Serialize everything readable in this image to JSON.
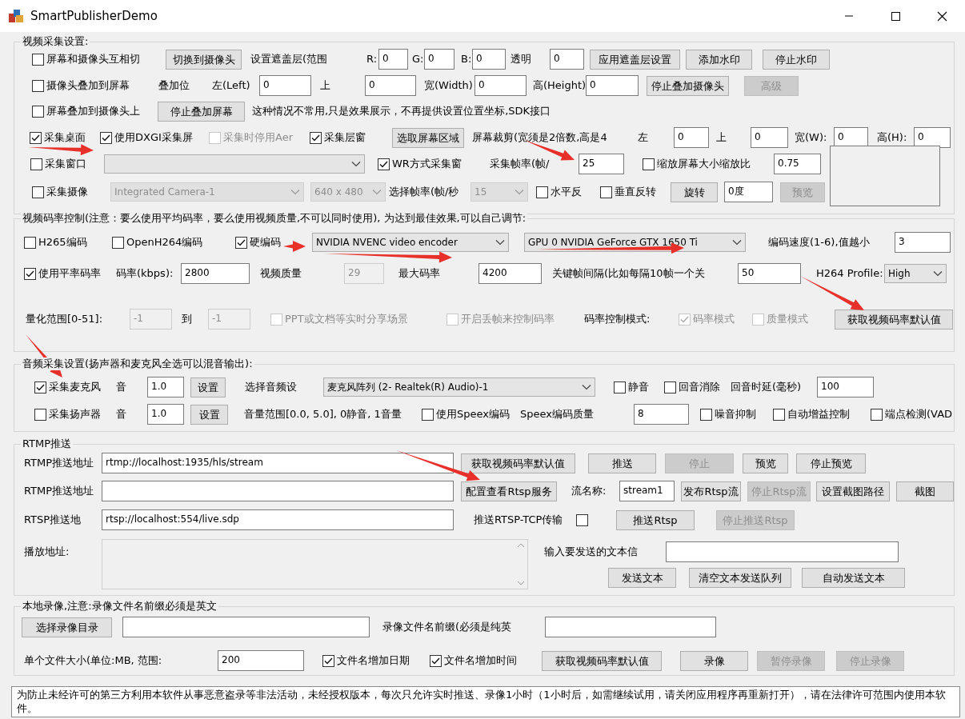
{
  "window": {
    "title": "SmartPublisherDemo"
  },
  "sections": [
    {
      "title": "视频采集设置:",
      "rows": [
        {
          "items": [
            {
              "kind": "checkbox",
              "label": "屏幕和摄像头互相切",
              "checked": false,
              "disabled": false
            },
            {
              "kind": "button",
              "label": "切换到摄像头",
              "disabled": false
            },
            {
              "kind": "label",
              "text": "设置遮盖层(范围"
            },
            {
              "kind": "label",
              "text": "R:"
            },
            {
              "kind": "field",
              "value": "0",
              "disabled": false
            },
            {
              "kind": "label",
              "text": "G:"
            },
            {
              "kind": "field",
              "value": "0",
              "disabled": false
            },
            {
              "kind": "label",
              "text": "B:"
            },
            {
              "kind": "field",
              "value": "0",
              "disabled": false
            },
            {
              "kind": "label",
              "text": "透明"
            },
            {
              "kind": "field",
              "value": "0",
              "disabled": false
            },
            {
              "kind": "button",
              "label": "应用遮盖层设置",
              "disabled": false
            },
            {
              "kind": "button",
              "label": "添加水印",
              "disabled": false
            },
            {
              "kind": "button",
              "label": "停止水印",
              "disabled": false
            }
          ]
        },
        {
          "items": [
            {
              "kind": "checkbox",
              "label": "摄像头叠加到屏幕",
              "checked": false,
              "disabled": false
            },
            {
              "kind": "label",
              "text": "叠加位"
            },
            {
              "kind": "label",
              "text": "左(Left)"
            },
            {
              "kind": "field",
              "value": "0",
              "disabled": false
            },
            {
              "kind": "label",
              "text": "上"
            },
            {
              "kind": "field",
              "value": "0",
              "disabled": false
            },
            {
              "kind": "label",
              "text": "宽(Width)"
            },
            {
              "kind": "field",
              "value": "0",
              "disabled": false
            },
            {
              "kind": "label",
              "text": "高(Height)"
            },
            {
              "kind": "field",
              "value": "0",
              "disabled": false
            },
            {
              "kind": "button",
              "label": "停止叠加摄像头",
              "disabled": false
            },
            {
              "kind": "button",
              "label": "高级",
              "disabled": true
            }
          ]
        },
        {
          "items": [
            {
              "kind": "checkbox",
              "label": "屏幕叠加到摄像头上",
              "checked": false,
              "disabled": false
            },
            {
              "kind": "button",
              "label": "停止叠加屏幕",
              "disabled": false
            },
            {
              "kind": "label",
              "text": "这种情况不常用,只是效果展示，不再提供设置位置坐标,SDK接口"
            }
          ]
        },
        {
          "items": [
            {
              "kind": "checkbox",
              "label": "采集桌面",
              "checked": true,
              "disabled": false
            },
            {
              "kind": "checkbox",
              "label": "使用DXGI采集屏",
              "checked": true,
              "disabled": false
            },
            {
              "kind": "checkbox",
              "label": "采集时停用Aer",
              "checked": false,
              "disabled": true
            },
            {
              "kind": "checkbox",
              "label": "采集层窗",
              "checked": true,
              "disabled": false
            },
            {
              "kind": "button",
              "label": "选取屏幕区域",
              "disabled": false
            },
            {
              "kind": "label",
              "text": "屏幕裁剪(宽须是2倍数,高是4"
            },
            {
              "kind": "label",
              "text": "左"
            },
            {
              "kind": "field",
              "value": "0",
              "disabled": false
            },
            {
              "kind": "label",
              "text": "上"
            },
            {
              "kind": "field",
              "value": "0",
              "disabled": false
            },
            {
              "kind": "label",
              "text": "宽(W):"
            },
            {
              "kind": "field",
              "value": "0",
              "disabled": false
            },
            {
              "kind": "label",
              "text": "高(H):"
            },
            {
              "kind": "field",
              "value": "0",
              "disabled": false
            }
          ]
        },
        {
          "items": [
            {
              "kind": "checkbox",
              "label": "采集窗口",
              "checked": false,
              "disabled": false
            },
            {
              "kind": "combo",
              "disabled": false
            },
            {
              "kind": "checkbox",
              "label": "WR方式采集窗",
              "checked": true,
              "disabled": false
            },
            {
              "kind": "label",
              "text": "采集帧率(帧/"
            },
            {
              "kind": "field",
              "value": "25",
              "disabled": false
            },
            {
              "kind": "checkbox",
              "label": "缩放屏幕大小缩放比",
              "checked": false,
              "disabled": false
            },
            {
              "kind": "field",
              "value": "0.75",
              "disabled": false
            },
            {
              "kind": "preview"
            }
          ]
        },
        {
          "items": [
            {
              "kind": "checkbox",
              "label": "采集摄像",
              "checked": false,
              "disabled": false
            },
            {
              "kind": "combo",
              "value": "Integrated Camera-1",
              "disabled": true
            },
            {
              "kind": "combo",
              "value": "640 x 480",
              "disabled": true
            },
            {
              "kind": "label",
              "text": "选择帧率(帧/秒"
            },
            {
              "kind": "combo",
              "value": "15",
              "disabled": true
            },
            {
              "kind": "checkbox",
              "label": "水平反",
              "checked": false,
              "disabled": false
            },
            {
              "kind": "checkbox",
              "label": "垂直反转",
              "checked": false,
              "disabled": false
            },
            {
              "kind": "button",
              "label": "旋转",
              "disabled": false
            },
            {
              "kind": "field",
              "value": "0度",
              "disabled": false
            },
            {
              "kind": "button",
              "label": "预览",
              "disabled": true
            }
          ]
        }
      ]
    },
    {
      "title": "视频码率控制(注意：要么使用平均码率，要么使用视频质量,不可以同时使用), 为达到最佳效果,可以自己调节:",
      "rows": [
        {
          "items": [
            {
              "kind": "checkbox",
              "label": "H265编码",
              "checked": false,
              "disabled": false
            },
            {
              "kind": "checkbox",
              "label": "OpenH264编码",
              "checked": false,
              "disabled": false
            },
            {
              "kind": "checkbox",
              "label": "硬编码",
              "checked": true,
              "disabled": false
            },
            {
              "kind": "combo",
              "value": "NVIDIA NVENC video encoder",
              "disabled": false
            },
            {
              "kind": "combo",
              "value": "GPU 0 NVIDIA GeForce GTX 1650 Ti",
              "disabled": false
            },
            {
              "kind": "label",
              "text": "编码速度(1-6),值越小"
            },
            {
              "kind": "field",
              "value": "3",
              "disabled": false
            }
          ]
        },
        {
          "items": [
            {
              "kind": "checkbox",
              "label": "使用平率码率",
              "checked": true,
              "disabled": false
            },
            {
              "kind": "label",
              "text": "码率(kbps):"
            },
            {
              "kind": "field",
              "value": "2800",
              "disabled": false
            },
            {
              "kind": "label",
              "text": "视频质量"
            },
            {
              "kind": "field",
              "value": "29",
              "disabled": true
            },
            {
              "kind": "label",
              "text": "最大码率"
            },
            {
              "kind": "field",
              "value": "4200",
              "disabled": false
            },
            {
              "kind": "label",
              "text": "关键帧间隔(比如每隔10帧一个关"
            },
            {
              "kind": "field",
              "value": "50",
              "disabled": false
            },
            {
              "kind": "label",
              "text": "H264 Profile:"
            },
            {
              "kind": "combo",
              "value": "High",
              "disabled": false
            }
          ]
        },
        {
          "items": [
            {
              "kind": "label",
              "text": "量化范围[0-51]:"
            },
            {
              "kind": "field",
              "value": "-1",
              "disabled": true
            },
            {
              "kind": "label",
              "text": "到"
            },
            {
              "kind": "field",
              "value": "-1",
              "disabled": true
            },
            {
              "kind": "checkbox",
              "label": "PPT或文档等实时分享场景",
              "checked": false,
              "disabled": true
            },
            {
              "kind": "checkbox",
              "label": "开启丢帧来控制码率",
              "checked": false,
              "disabled": true
            },
            {
              "kind": "label",
              "text": "码率控制模式:"
            },
            {
              "kind": "checkbox",
              "label": "码率模式",
              "checked": true,
              "disabled": true
            },
            {
              "kind": "checkbox",
              "label": "质量模式",
              "checked": false,
              "disabled": true
            },
            {
              "kind": "button",
              "label": "获取视频码率默认值",
              "disabled": false
            }
          ]
        }
      ]
    },
    {
      "title": "音频采集设置(扬声器和麦克风全选可以混音输出):",
      "rows": [
        {
          "items": [
            {
              "kind": "checkbox",
              "label": "采集麦克风",
              "checked": true,
              "disabled": false
            },
            {
              "kind": "label",
              "text": "音"
            },
            {
              "kind": "field",
              "value": "1.0",
              "disabled": false
            },
            {
              "kind": "button",
              "label": "设置",
              "disabled": false
            },
            {
              "kind": "label",
              "text": "选择音频设"
            },
            {
              "kind": "combo",
              "value": "麦克风阵列 (2- Realtek(R) Audio)-1",
              "disabled": false
            },
            {
              "kind": "checkbox",
              "label": "静音",
              "checked": false,
              "disabled": false
            },
            {
              "kind": "checkbox",
              "label": "回音消除",
              "checked": false,
              "disabled": false
            },
            {
              "kind": "label",
              "text": "回音时延(毫秒)"
            },
            {
              "kind": "field",
              "value": "100",
              "disabled": false
            }
          ]
        },
        {
          "items": [
            {
              "kind": "checkbox",
              "label": "采集扬声器",
              "checked": false,
              "disabled": false
            },
            {
              "kind": "label",
              "text": "音"
            },
            {
              "kind": "field",
              "value": "1.0",
              "disabled": false
            },
            {
              "kind": "button",
              "label": "设置",
              "disabled": false
            },
            {
              "kind": "label",
              "text": "音量范围[0.0, 5.0], 0静音, 1音量"
            },
            {
              "kind": "checkbox",
              "label": "使用Speex编码",
              "checked": false,
              "disabled": false
            },
            {
              "kind": "label",
              "text": "Speex编码质量"
            },
            {
              "kind": "field",
              "value": "8",
              "disabled": false
            },
            {
              "kind": "checkbox",
              "label": "噪音抑制",
              "checked": false,
              "disabled": false
            },
            {
              "kind": "checkbox",
              "label": "自动增益控制",
              "checked": false,
              "disabled": false
            },
            {
              "kind": "checkbox",
              "label": "端点检测(VAD",
              "checked": false,
              "disabled": false
            }
          ]
        }
      ]
    },
    {
      "title": "RTMP推送",
      "rows": [
        {
          "items": [
            {
              "kind": "label",
              "text": "RTMP推送地址"
            },
            {
              "kind": "field",
              "value": "rtmp://localhost:1935/hls/stream",
              "disabled": false
            },
            {
              "kind": "button",
              "label": "获取视频码率默认值",
              "disabled": false
            },
            {
              "kind": "button",
              "label": "推送",
              "disabled": false
            },
            {
              "kind": "button",
              "label": "停止",
              "disabled": true
            },
            {
              "kind": "button",
              "label": "预览",
              "disabled": false
            },
            {
              "kind": "button",
              "label": "停止预览",
              "disabled": false
            }
          ]
        },
        {
          "items": [
            {
              "kind": "label",
              "text": "RTMP推送地址"
            },
            {
              "kind": "field",
              "disabled": false
            },
            {
              "kind": "button",
              "label": "配置查看Rtsp服务",
              "disabled": false
            },
            {
              "kind": "label",
              "text": "流名称:"
            },
            {
              "kind": "field",
              "value": "stream1",
              "disabled": false
            },
            {
              "kind": "button",
              "label": "发布Rtsp流",
              "disabled": false
            },
            {
              "kind": "button",
              "label": "停止Rtsp流",
              "disabled": true
            },
            {
              "kind": "button",
              "label": "设置截图路径",
              "disabled": false
            },
            {
              "kind": "button",
              "label": "截图",
              "disabled": false
            }
          ]
        },
        {
          "items": [
            {
              "kind": "label",
              "text": "RTSP推送地"
            },
            {
              "kind": "field",
              "value": "rtsp://localhost:554/live.sdp",
              "disabled": false
            },
            {
              "kind": "label",
              "text": "推送RTSP-TCP传输"
            },
            {
              "kind": "checkbox",
              "checked": false,
              "disabled": false
            },
            {
              "kind": "button",
              "label": "推送Rtsp",
              "disabled": false
            },
            {
              "kind": "button",
              "label": "停止推送Rtsp",
              "disabled": true
            }
          ]
        },
        {
          "items": [
            {
              "kind": "label",
              "text": "播放地址:"
            },
            {
              "kind": "textarea",
              "disabled": true
            },
            {
              "kind": "label",
              "text": "输入要发送的文本信"
            },
            {
              "kind": "field",
              "disabled": false
            }
          ]
        },
        {
          "items": [
            {
              "kind": "button",
              "label": "发送文本",
              "disabled": false
            },
            {
              "kind": "button",
              "label": "清空文本发送队列",
              "disabled": false
            },
            {
              "kind": "button",
              "label": "自动发送文本",
              "disabled": false
            }
          ]
        }
      ]
    },
    {
      "title": "本地录像,注意:录像文件名前缀必须是英文",
      "rows": [
        {
          "items": [
            {
              "kind": "button",
              "label": "选择录像目录",
              "disabled": false
            },
            {
              "kind": "field",
              "disabled": false
            },
            {
              "kind": "label",
              "text": "录像文件名前缀(必须是纯英"
            },
            {
              "kind": "field",
              "disabled": false
            }
          ]
        },
        {
          "items": [
            {
              "kind": "label",
              "text": "单个文件大小(单位:MB, 范围:"
            },
            {
              "kind": "field",
              "value": "200",
              "disabled": false
            },
            {
              "kind": "checkbox",
              "label": "文件名增加日期",
              "checked": true,
              "disabled": false
            },
            {
              "kind": "checkbox",
              "label": "文件名增加时间",
              "checked": true,
              "disabled": false
            },
            {
              "kind": "button",
              "label": "获取视频码率默认值",
              "disabled": false
            },
            {
              "kind": "button",
              "label": "录像",
              "disabled": false
            },
            {
              "kind": "button",
              "label": "暂停录像",
              "disabled": true
            },
            {
              "kind": "button",
              "label": "停止录像",
              "disabled": true
            }
          ]
        }
      ]
    }
  ],
  "notice": "为防止未经许可的第三方利用本软件从事恶意盗录等非法活动，未经授权版本，每次只允许实时推送、录像1小时（1小时后，如需继续试用，请关闭应用程序再重新打开），请在法律许可范围内使用本软件。"
}
